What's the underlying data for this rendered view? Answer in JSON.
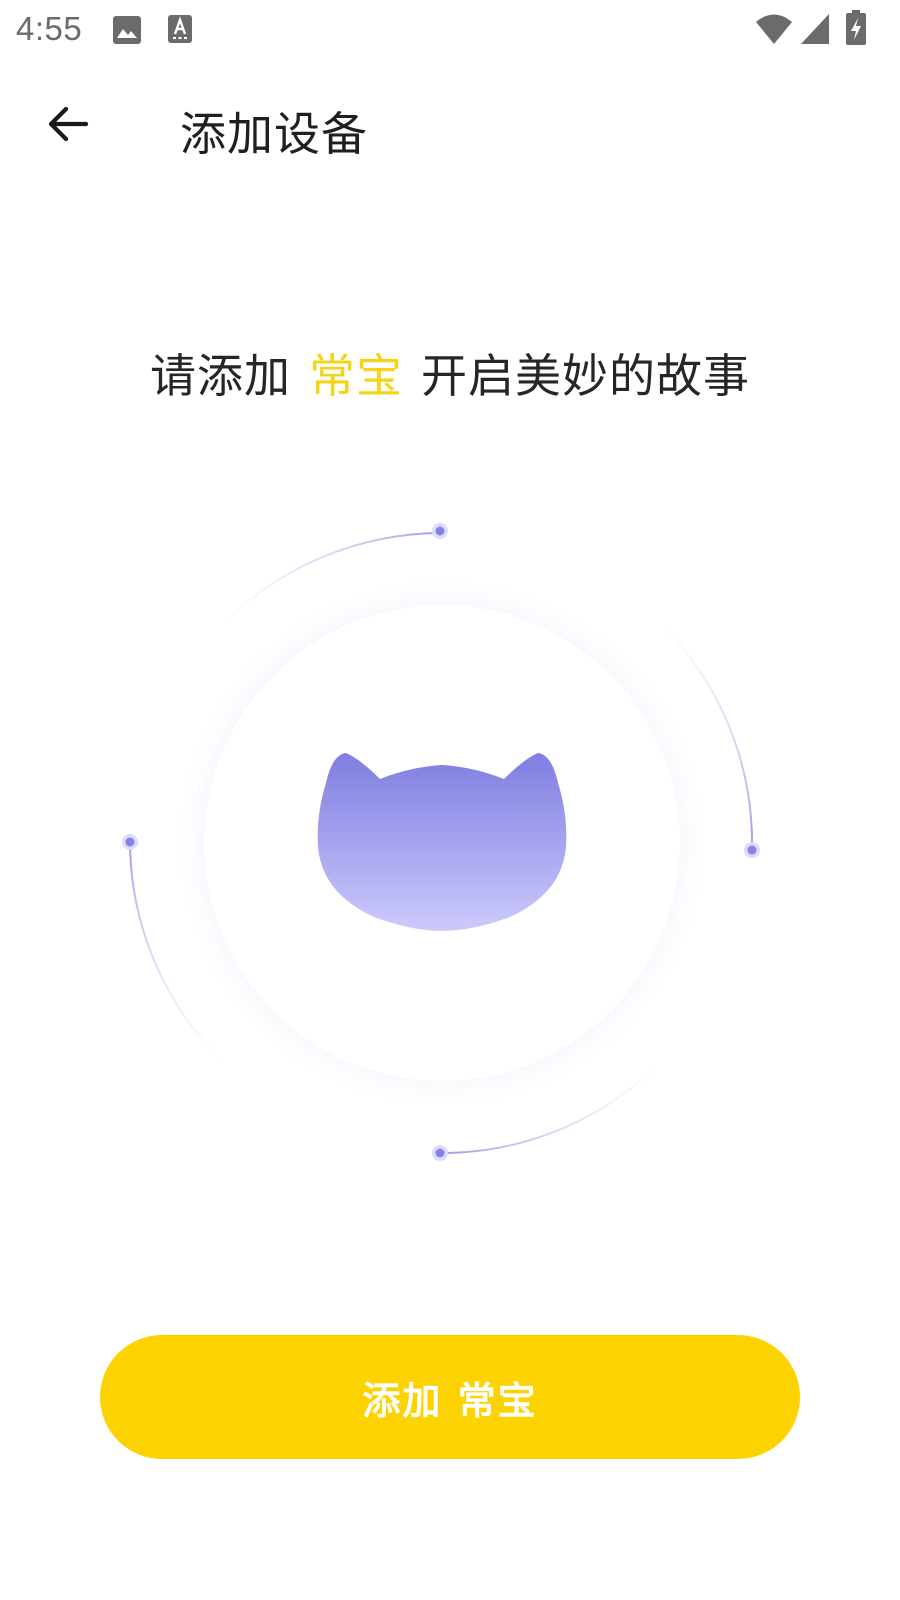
{
  "status_bar": {
    "time": "4:55",
    "icons": [
      "image-notification-icon",
      "keyboard-notification-icon",
      "wifi-icon",
      "cellular-signal-icon",
      "battery-charging-icon"
    ]
  },
  "app_bar": {
    "back_icon": "arrow-left-icon",
    "title": "添加设备"
  },
  "headline": {
    "prefix": "请添加",
    "device_name": "常宝",
    "suffix": "开启美妙的故事"
  },
  "illustration": {
    "icon": "cat-head-icon"
  },
  "primary_button": {
    "label": "添加 常宝"
  },
  "colors": {
    "accent_yellow": "#fcd300",
    "accent_text_yellow": "#f7d317",
    "illustration_purple": "#8c8ce8",
    "button_text": "#ffffff"
  }
}
